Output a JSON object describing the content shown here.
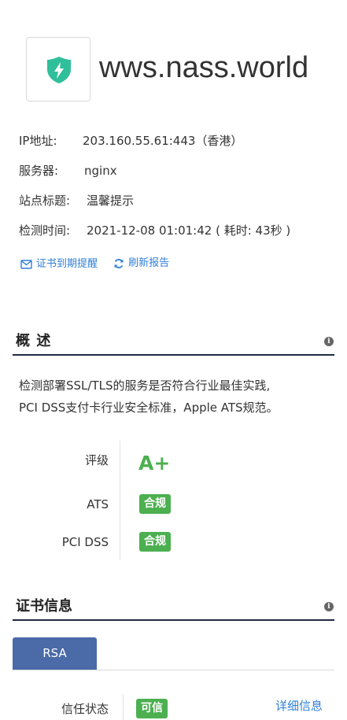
{
  "site": {
    "domain": "wws.nass.world"
  },
  "info": {
    "ip_label": "IP地址:",
    "ip_value": "203.160.55.61:443（香港）",
    "server_label": "服务器:",
    "server_value": "nginx",
    "title_label": "站点标题:",
    "title_value": "温馨提示",
    "time_label": "检测时间:",
    "time_value": "2021-12-08 01:01:42 ( 耗时: 43秒 )"
  },
  "actions": {
    "cert_reminder": "证书到期提醒",
    "refresh_report": "刷新报告"
  },
  "overview": {
    "title": "概 述",
    "desc_line1": "检测部署SSL/TLS的服务是否符合行业最佳实践,",
    "desc_line2": "PCI DSS支付卡行业安全标准，Apple ATS规范。",
    "grade_label": "评级",
    "grade_value": "A+",
    "ats_label": "ATS",
    "ats_value": "合规",
    "pci_label": "PCI DSS",
    "pci_value": "合规"
  },
  "cert": {
    "title": "证书信息",
    "tab_rsa": "RSA",
    "trust_label": "信任状态",
    "trust_value": "可信",
    "detail_link": "详细信息"
  },
  "colors": {
    "accent_green": "#4caf50",
    "link_blue": "#2f7fd8",
    "tab_blue": "#4a6aa8",
    "section_line": "#1f2a44"
  }
}
